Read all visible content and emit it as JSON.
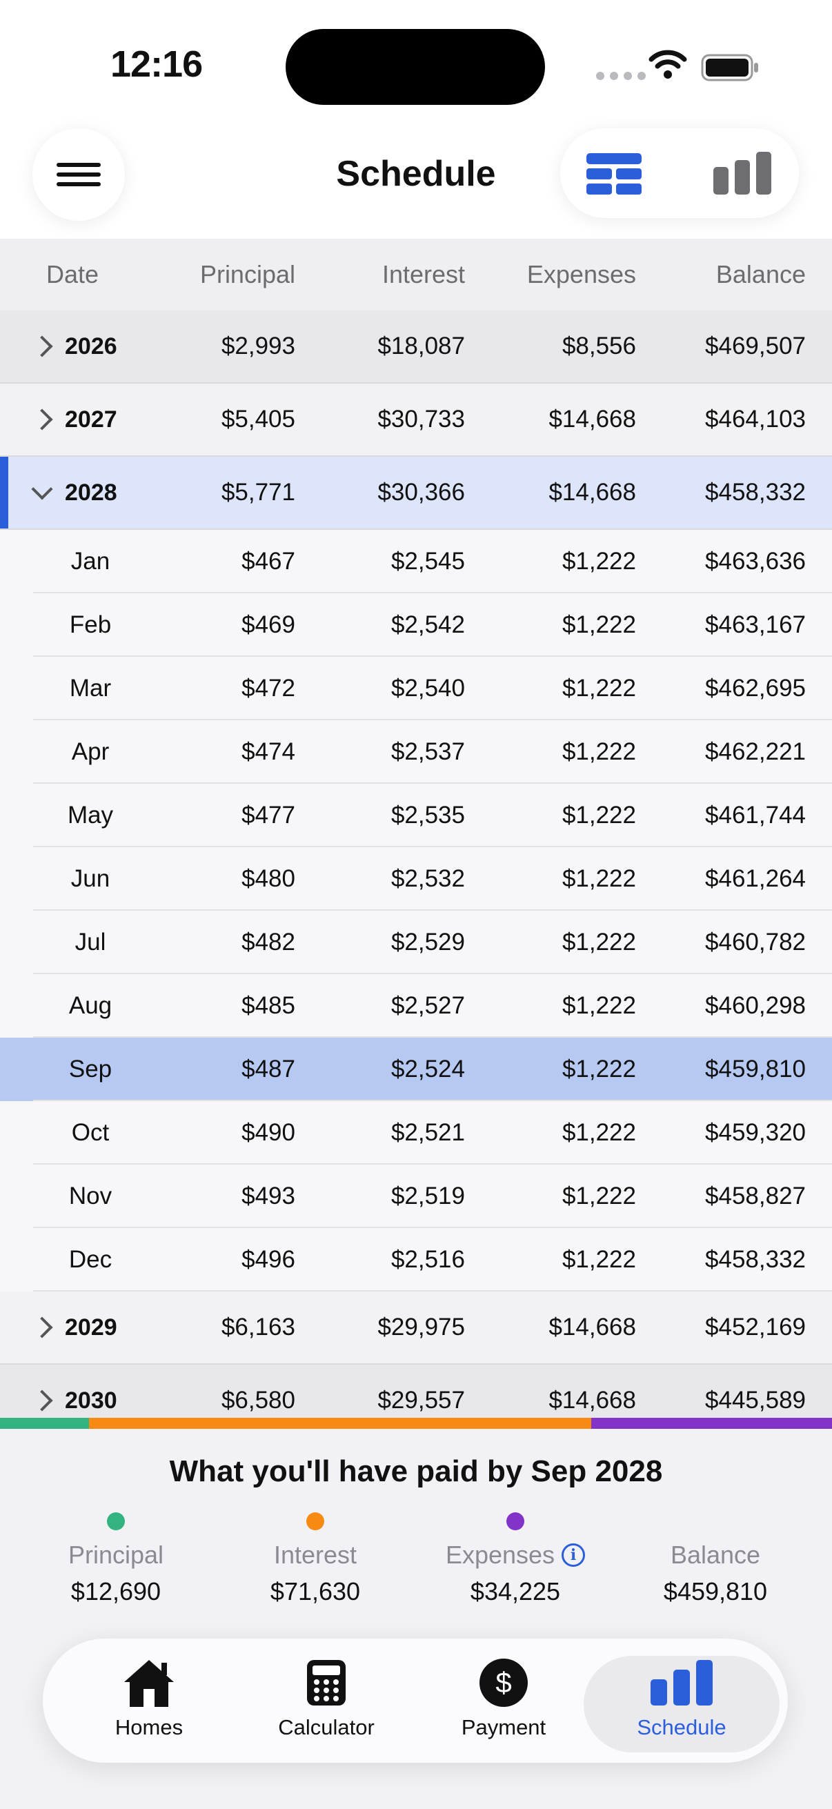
{
  "status": {
    "time": "12:16"
  },
  "header": {
    "title": "Schedule",
    "view_icons": [
      "table-icon",
      "bar-chart-icon"
    ],
    "active_view": "table"
  },
  "table": {
    "columns": [
      "Date",
      "Principal",
      "Interest",
      "Expenses",
      "Balance"
    ],
    "years_before": [
      {
        "date": "2026",
        "principal": "$2,993",
        "interest": "$18,087",
        "expenses": "$8,556",
        "balance": "$469,507"
      },
      {
        "date": "2027",
        "principal": "$5,405",
        "interest": "$30,733",
        "expenses": "$14,668",
        "balance": "$464,103"
      }
    ],
    "expanded_year": {
      "date": "2028",
      "principal": "$5,771",
      "interest": "$30,366",
      "expenses": "$14,668",
      "balance": "$458,332"
    },
    "months": [
      {
        "date": "Jan",
        "principal": "$467",
        "interest": "$2,545",
        "expenses": "$1,222",
        "balance": "$463,636"
      },
      {
        "date": "Feb",
        "principal": "$469",
        "interest": "$2,542",
        "expenses": "$1,222",
        "balance": "$463,167"
      },
      {
        "date": "Mar",
        "principal": "$472",
        "interest": "$2,540",
        "expenses": "$1,222",
        "balance": "$462,695"
      },
      {
        "date": "Apr",
        "principal": "$474",
        "interest": "$2,537",
        "expenses": "$1,222",
        "balance": "$462,221"
      },
      {
        "date": "May",
        "principal": "$477",
        "interest": "$2,535",
        "expenses": "$1,222",
        "balance": "$461,744"
      },
      {
        "date": "Jun",
        "principal": "$480",
        "interest": "$2,532",
        "expenses": "$1,222",
        "balance": "$461,264"
      },
      {
        "date": "Jul",
        "principal": "$482",
        "interest": "$2,529",
        "expenses": "$1,222",
        "balance": "$460,782"
      },
      {
        "date": "Aug",
        "principal": "$485",
        "interest": "$2,527",
        "expenses": "$1,222",
        "balance": "$460,298"
      },
      {
        "date": "Sep",
        "principal": "$487",
        "interest": "$2,524",
        "expenses": "$1,222",
        "balance": "$459,810"
      },
      {
        "date": "Oct",
        "principal": "$490",
        "interest": "$2,521",
        "expenses": "$1,222",
        "balance": "$459,320"
      },
      {
        "date": "Nov",
        "principal": "$493",
        "interest": "$2,519",
        "expenses": "$1,222",
        "balance": "$458,827"
      },
      {
        "date": "Dec",
        "principal": "$496",
        "interest": "$2,516",
        "expenses": "$1,222",
        "balance": "$458,332"
      }
    ],
    "selected_month": "Sep",
    "years_after": [
      {
        "date": "2029",
        "principal": "$6,163",
        "interest": "$29,975",
        "expenses": "$14,668",
        "balance": "$452,169"
      },
      {
        "date": "2030",
        "principal": "$6,580",
        "interest": "$29,557",
        "expenses": "$14,668",
        "balance": "$445,589"
      }
    ]
  },
  "summary": {
    "title": "What you'll have paid by Sep 2028",
    "items": [
      {
        "label": "Principal",
        "value": "$12,690",
        "color": "#32b37f"
      },
      {
        "label": "Interest",
        "value": "$71,630",
        "color": "#f68a12"
      },
      {
        "label": "Expenses",
        "value": "$34,225",
        "color": "#8134c7"
      },
      {
        "label": "Balance",
        "value": "$459,810",
        "color": ""
      }
    ],
    "bar_fractions": {
      "principal": 0.107,
      "interest": 0.604,
      "expenses": 0.289
    }
  },
  "tabbar": {
    "tabs": [
      {
        "label": "Homes",
        "icon": "house-icon"
      },
      {
        "label": "Calculator",
        "icon": "calculator-icon"
      },
      {
        "label": "Payment",
        "icon": "dollar-icon"
      },
      {
        "label": "Schedule",
        "icon": "bar-chart-icon"
      }
    ],
    "active": "Schedule",
    "accent": "#2b5fd9"
  }
}
